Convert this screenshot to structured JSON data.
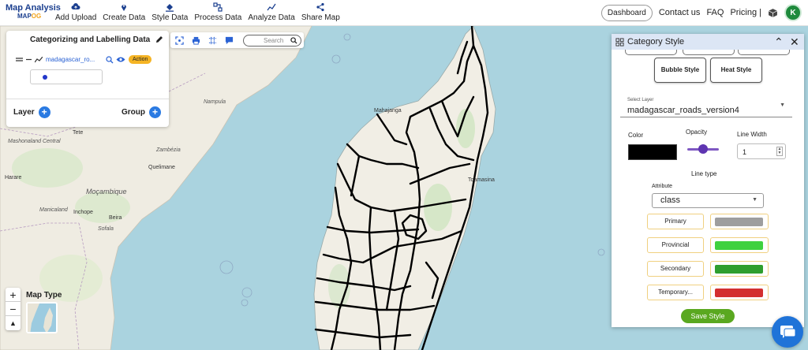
{
  "brand": {
    "title": "Map Analysis",
    "sub_prefix": "MAP",
    "sub_suffix": "OG"
  },
  "nav": [
    {
      "label": "Add Upload",
      "icon": "cloud-upload-icon"
    },
    {
      "label": "Create Data",
      "icon": "map-pin-icon"
    },
    {
      "label": "Style Data",
      "icon": "paint-bucket-icon"
    },
    {
      "label": "Process Data",
      "icon": "process-icon"
    },
    {
      "label": "Analyze Data",
      "icon": "analyze-icon"
    },
    {
      "label": "Share Map",
      "icon": "share-icon"
    }
  ],
  "right_nav": {
    "dashboard": "Dashboard",
    "contact": "Contact us",
    "faq": "FAQ",
    "pricing": "Pricing |",
    "avatar": "K"
  },
  "layer_panel": {
    "title": "Categorizing and Labelling Data",
    "layer_name": "madagascar_ro...",
    "action": "Action",
    "layer_label": "Layer",
    "group_label": "Group"
  },
  "map_tools": {
    "search_placeholder": "Search"
  },
  "zoom": {
    "in": "+",
    "out": "−",
    "reset": "▲"
  },
  "map_type": {
    "label": "Map Type"
  },
  "map_labels": {
    "mahajanga": "Mahajanga",
    "toamasina": "Toamasina",
    "harare": "Harare",
    "mozambique": "Moçambique",
    "beira": "Beira",
    "tete": "Tete",
    "zambezia": "Zambézia",
    "quelimane": "Quelimane",
    "nampula": "Nampula",
    "manica": "Manicaland",
    "inhope": "Inchope",
    "sofala": "Sofala",
    "mashona": "Mashonaland Central"
  },
  "style_panel": {
    "title": "Category Style",
    "bubble": "Bubble Style",
    "heat": "Heat Style",
    "select_layer_label": "Select Layer",
    "select_layer_value": "madagascar_roads_version4",
    "color_label": "Color",
    "opacity_label": "Opacity",
    "line_width_label": "Line Width",
    "line_width_value": "1",
    "line_type_label": "Line type",
    "attribute_label": "Attribute",
    "attribute_value": "class",
    "categories": [
      {
        "label": "Primary",
        "color": "#9e9e9e"
      },
      {
        "label": "Provincial",
        "color": "#3fd13f"
      },
      {
        "label": "Secondary",
        "color": "#2e9e2e"
      },
      {
        "label": "Temporary...",
        "color": "#d32f2f"
      }
    ],
    "save": "Save Style",
    "opacity_value": 0.5
  },
  "colors": {
    "accent": "#2a7ae2",
    "water": "#aad3df",
    "land": "#f0ede4",
    "roads": "#000000"
  }
}
